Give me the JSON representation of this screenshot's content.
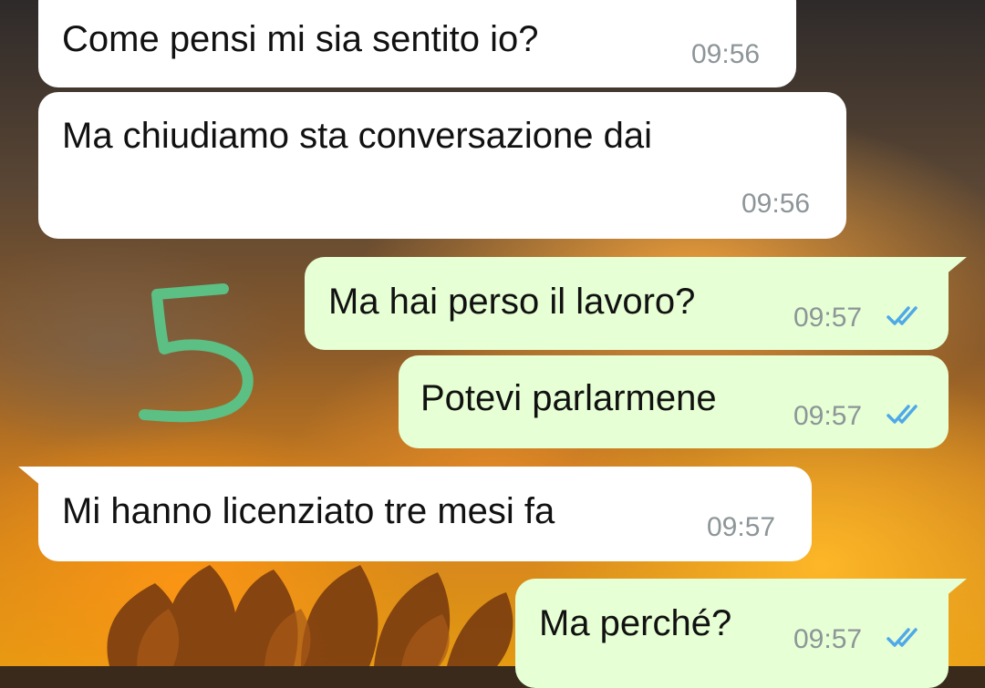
{
  "conversation": {
    "messages": [
      {
        "direction": "incoming",
        "text": "Come pensi mi sia sentito io?",
        "time": "09:56",
        "read": false
      },
      {
        "direction": "incoming",
        "text": "Ma chiudiamo sta conversazione dai",
        "time": "09:56",
        "read": false
      },
      {
        "direction": "outgoing",
        "text": "Ma hai perso il lavoro?",
        "time": "09:57",
        "read": true
      },
      {
        "direction": "outgoing",
        "text": "Potevi parlarmene",
        "time": "09:57",
        "read": true
      },
      {
        "direction": "incoming",
        "text": "Mi hanno licenziato tre mesi fa",
        "time": "09:57",
        "read": false
      },
      {
        "direction": "outgoing",
        "text": "Ma perché?",
        "time": "09:57",
        "read": true
      }
    ]
  },
  "overlay": {
    "annotation": "5",
    "annotation_color": "#5cbf84"
  },
  "colors": {
    "incoming_bubble": "#ffffff",
    "outgoing_bubble": "#e6ffd4",
    "timestamp": "#8d9598",
    "read_ticks": "#4fa8e8"
  },
  "icons": {
    "read_receipt": "double-check-icon"
  }
}
